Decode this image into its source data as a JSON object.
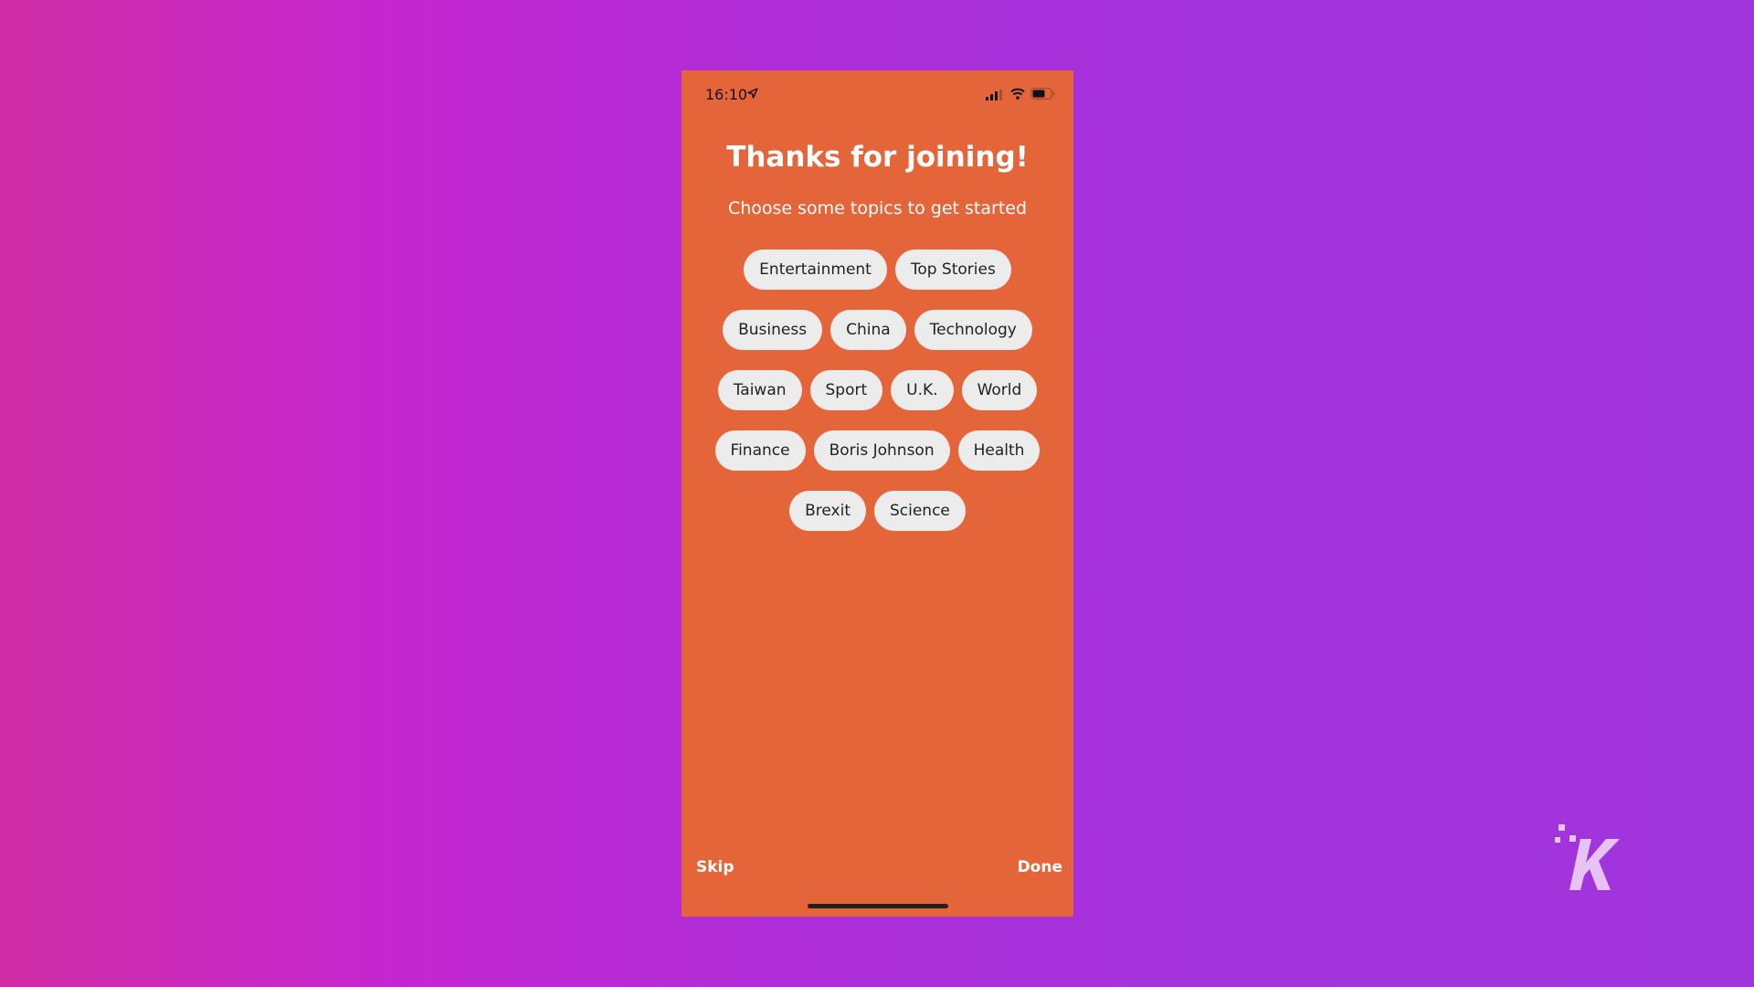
{
  "status_bar": {
    "time": "16:10"
  },
  "screen": {
    "title": "Thanks for joining!",
    "subtitle": "Choose some topics to get started",
    "topics": [
      [
        "Entertainment",
        "Top Stories"
      ],
      [
        "Business",
        "China",
        "Technology"
      ],
      [
        "Taiwan",
        "Sport",
        "U.K.",
        "World"
      ],
      [
        "Finance",
        "Boris Johnson",
        "Health"
      ],
      [
        "Brexit",
        "Science"
      ]
    ],
    "skip_label": "Skip",
    "done_label": "Done"
  },
  "icons": {
    "status": [
      "location-arrow-icon",
      "signal-icon",
      "wifi-icon",
      "battery-icon"
    ],
    "watermark": "knowtechie-k-logo"
  },
  "colors": {
    "screen_background": "#e5653b",
    "chip_background": "#ececec",
    "page_gradient": [
      "#d02ea6",
      "#a135dc"
    ]
  }
}
